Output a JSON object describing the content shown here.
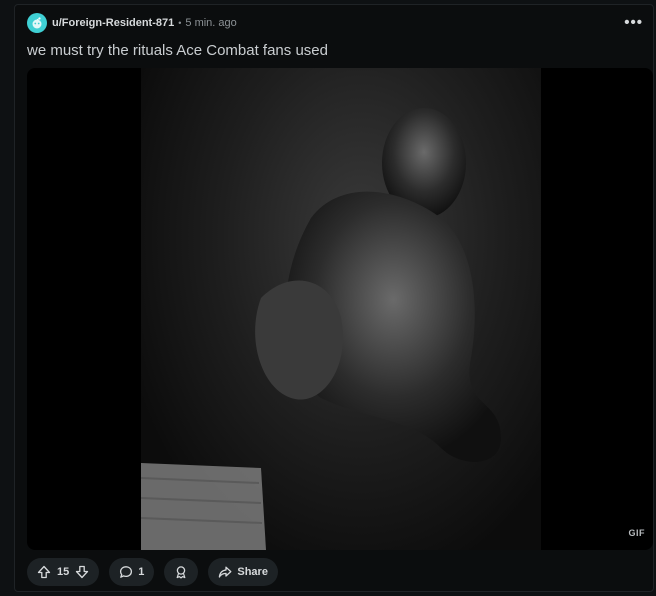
{
  "post": {
    "username": "u/Foreign-Resident-871",
    "separator": "•",
    "timestamp": "5 min. ago",
    "menu_label": "•••",
    "title": "we must try the rituals Ace Combat fans used",
    "media_badge": "GIF",
    "media_description_icon": "gif-frame",
    "upvotes": "15",
    "comments": "1",
    "share_label": "Share"
  },
  "colors": {
    "background": "#0e1113",
    "card": "#0b0d0e",
    "pill": "#1d2225",
    "avatar": "#3fd0d4",
    "muted_text": "#8c9296"
  }
}
